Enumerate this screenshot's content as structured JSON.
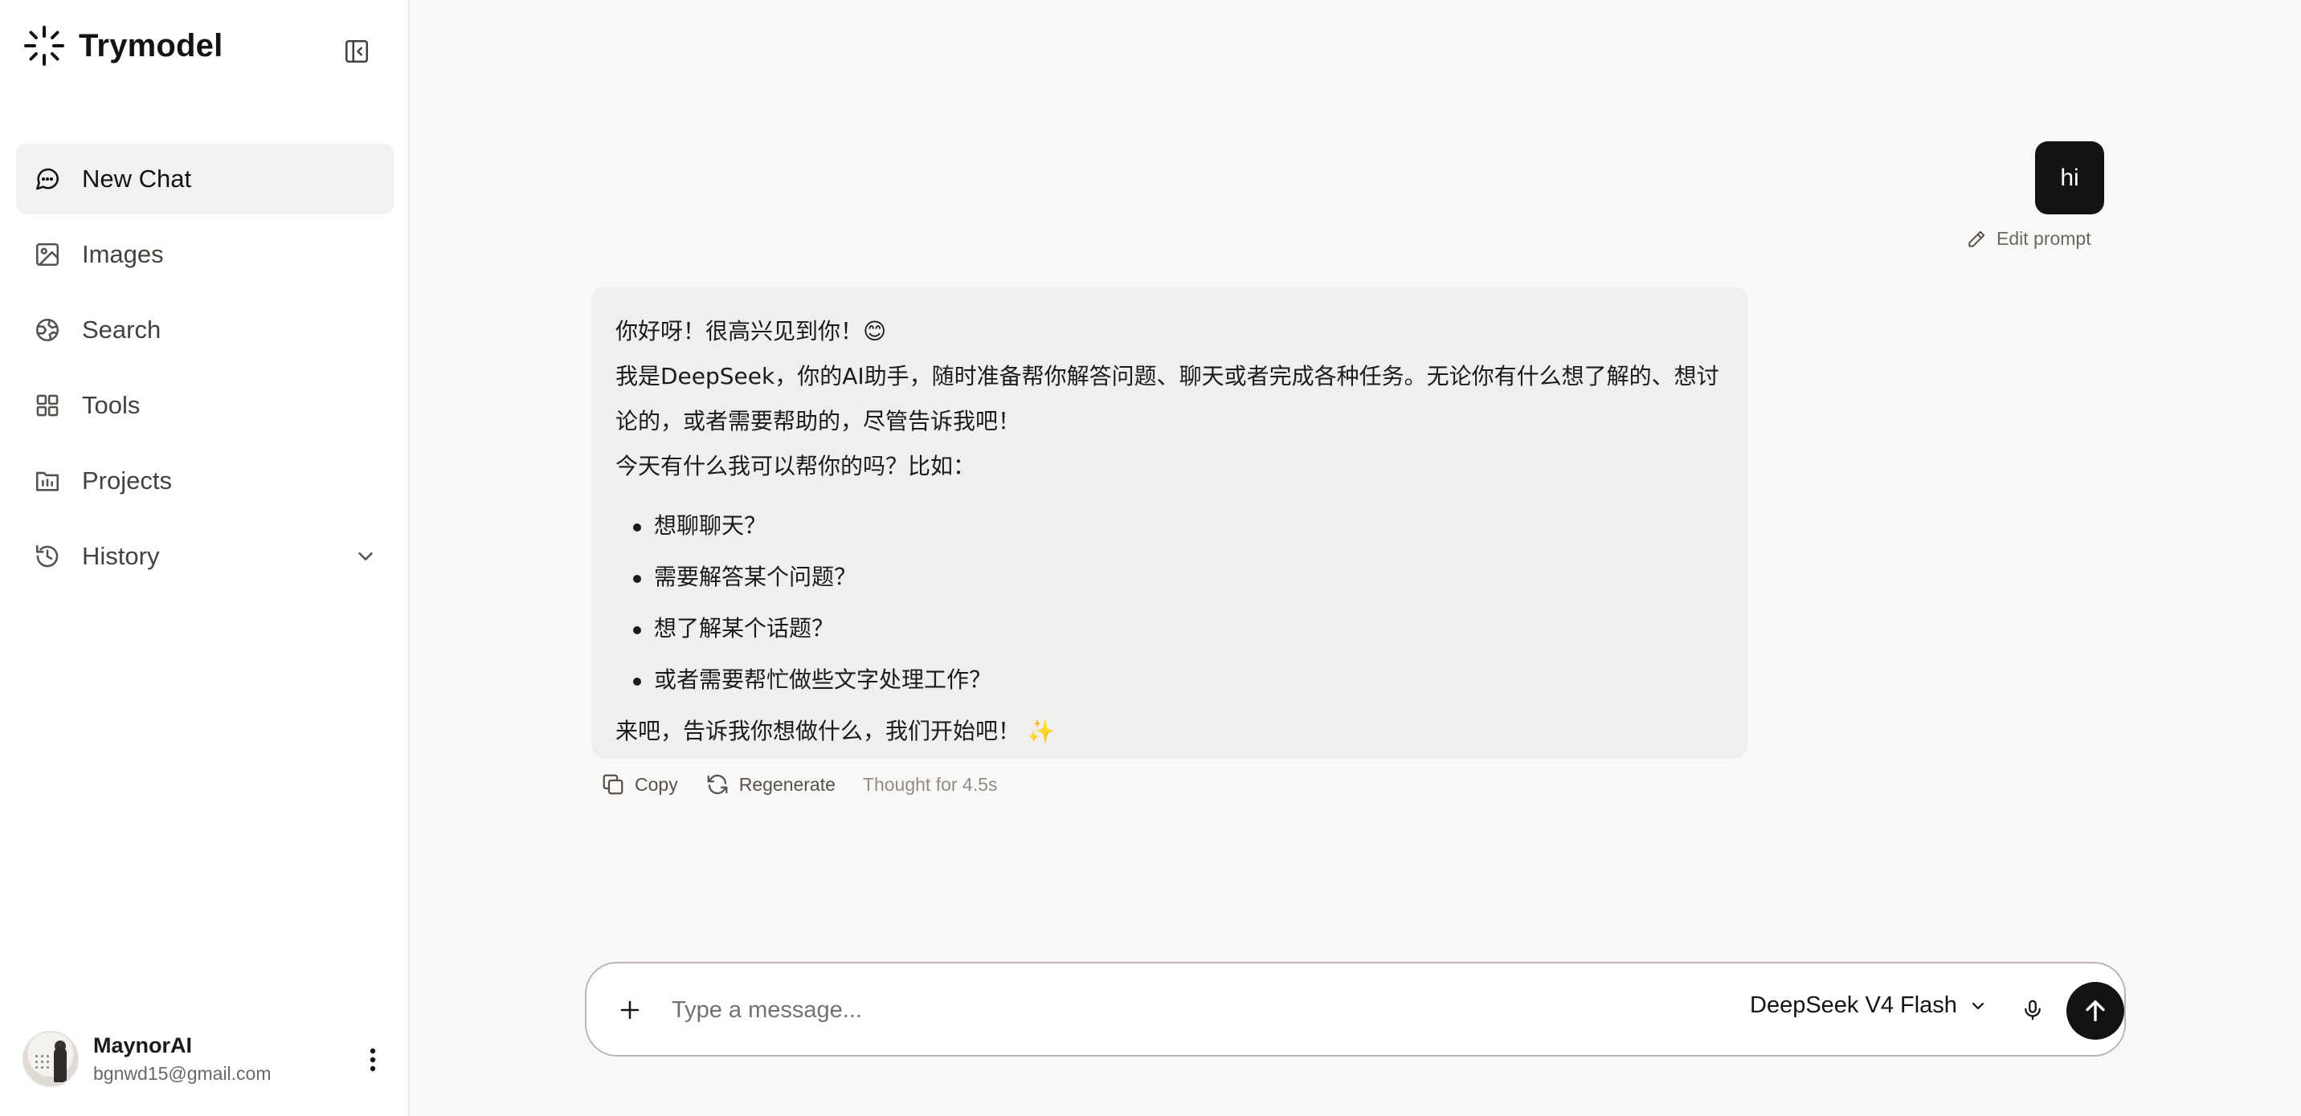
{
  "app": {
    "name": "Trymodel"
  },
  "sidebar": {
    "items": [
      {
        "label": "New Chat",
        "icon": "chat-bubble-icon",
        "active": true
      },
      {
        "label": "Images",
        "icon": "image-icon"
      },
      {
        "label": "Search",
        "icon": "globe-icon"
      },
      {
        "label": "Tools",
        "icon": "grid-icon"
      },
      {
        "label": "Projects",
        "icon": "folder-icon"
      },
      {
        "label": "History",
        "icon": "history-icon",
        "expandable": true
      }
    ],
    "user": {
      "name": "MaynorAI",
      "email": "bgnwd15@gmail.com"
    }
  },
  "chat": {
    "user_message": "hi",
    "edit_prompt_label": "Edit prompt",
    "assistant": {
      "greeting": "你好呀！很高兴见到你！😊",
      "intro": "我是DeepSeek，你的AI助手，随时准备帮你解答问题、聊天或者完成各种任务。无论你有什么想了解的、想讨论的，或者需要帮助的，尽管告诉我吧！",
      "question": "今天有什么我可以帮你的吗？比如：",
      "bullets": [
        "想聊聊天？",
        "需要解答某个问题？",
        "想了解某个话题？",
        "或者需要帮忙做些文字处理工作？"
      ],
      "closing": "来吧，告诉我你想做什么，我们开始吧！",
      "closing_emoji": "✨"
    },
    "actions": {
      "copy": "Copy",
      "regenerate": "Regenerate",
      "thought": "Thought for 4.5s"
    }
  },
  "composer": {
    "placeholder": "Type a message...",
    "value": "",
    "model": "DeepSeek V4 Flash"
  },
  "colors": {
    "accent": "#141312",
    "sidebar_bg": "#ffffff",
    "main_bg": "#f9f8f6",
    "bubble_bg": "#f0efed"
  }
}
